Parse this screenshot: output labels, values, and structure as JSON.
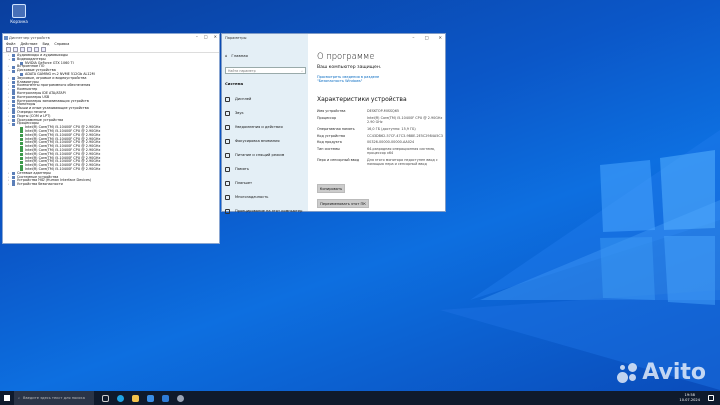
{
  "desktop": {
    "recycle_bin_label": "Корзина"
  },
  "device_manager": {
    "title": "Диспетчер устройств",
    "menu": [
      "Файл",
      "Действие",
      "Вид",
      "Справка"
    ],
    "tree": [
      {
        "label": "Аудиовходы и аудиовыходы",
        "level": 1,
        "arrow": "›"
      },
      {
        "label": "Видеоадаптеры",
        "level": 1,
        "arrow": "⌄"
      },
      {
        "label": "NVIDIA GeForce GTX 1060 TI",
        "level": 2,
        "arrow": ""
      },
      {
        "label": "Встроенное ПО",
        "level": 1,
        "arrow": "›"
      },
      {
        "label": "Дисковые устройства",
        "level": 1,
        "arrow": "⌄"
      },
      {
        "label": "ADATA GAMING m.2 NVME 512Gb AL12M",
        "level": 2,
        "arrow": ""
      },
      {
        "label": "Звуковые, игровые и видеоустройства",
        "level": 1,
        "arrow": "›"
      },
      {
        "label": "Клавиатуры",
        "level": 1,
        "arrow": "›"
      },
      {
        "label": "Компоненты программного обеспечения",
        "level": 1,
        "arrow": "›"
      },
      {
        "label": "Компьютер",
        "level": 1,
        "arrow": "›"
      },
      {
        "label": "Контроллеры IDE ATA/ATAPI",
        "level": 1,
        "arrow": "›"
      },
      {
        "label": "Контроллеры USB",
        "level": 1,
        "arrow": "›"
      },
      {
        "label": "Контроллеры запоминающих устройств",
        "level": 1,
        "arrow": "›"
      },
      {
        "label": "Мониторы",
        "level": 1,
        "arrow": "›"
      },
      {
        "label": "Мыши и иные указывающие устройства",
        "level": 1,
        "arrow": "›"
      },
      {
        "label": "Очереди печати",
        "level": 1,
        "arrow": "›"
      },
      {
        "label": "Порты (COM и LPT)",
        "level": 1,
        "arrow": "›"
      },
      {
        "label": "Программные устройства",
        "level": 1,
        "arrow": "›"
      },
      {
        "label": "Процессоры",
        "level": 1,
        "arrow": "⌄"
      },
      {
        "label": "Intel(R) Core(TM) i5-10400F CPU @ 2.90GHz",
        "level": 2,
        "arrow": "",
        "cpu": true
      },
      {
        "label": "Intel(R) Core(TM) i5-10400F CPU @ 2.90GHz",
        "level": 2,
        "arrow": "",
        "cpu": true
      },
      {
        "label": "Intel(R) Core(TM) i5-10400F CPU @ 2.90GHz",
        "level": 2,
        "arrow": "",
        "cpu": true
      },
      {
        "label": "Intel(R) Core(TM) i5-10400F CPU @ 2.90GHz",
        "level": 2,
        "arrow": "",
        "cpu": true
      },
      {
        "label": "Intel(R) Core(TM) i5-10400F CPU @ 2.90GHz",
        "level": 2,
        "arrow": "",
        "cpu": true
      },
      {
        "label": "Intel(R) Core(TM) i5-10400F CPU @ 2.90GHz",
        "level": 2,
        "arrow": "",
        "cpu": true
      },
      {
        "label": "Intel(R) Core(TM) i5-10400F CPU @ 2.90GHz",
        "level": 2,
        "arrow": "",
        "cpu": true
      },
      {
        "label": "Intel(R) Core(TM) i5-10400F CPU @ 2.90GHz",
        "level": 2,
        "arrow": "",
        "cpu": true
      },
      {
        "label": "Intel(R) Core(TM) i5-10400F CPU @ 2.90GHz",
        "level": 2,
        "arrow": "",
        "cpu": true
      },
      {
        "label": "Intel(R) Core(TM) i5-10400F CPU @ 2.90GHz",
        "level": 2,
        "arrow": "",
        "cpu": true
      },
      {
        "label": "Intel(R) Core(TM) i5-10400F CPU @ 2.90GHz",
        "level": 2,
        "arrow": "",
        "cpu": true
      },
      {
        "label": "Intel(R) Core(TM) i5-10400F CPU @ 2.90GHz",
        "level": 2,
        "arrow": "",
        "cpu": true
      },
      {
        "label": "Сетевые адаптеры",
        "level": 1,
        "arrow": "›"
      },
      {
        "label": "Системные устройства",
        "level": 1,
        "arrow": "›"
      },
      {
        "label": "Устройства HID (Human Interface Devices)",
        "level": 1,
        "arrow": "›"
      },
      {
        "label": "Устройства безопасности",
        "level": 1,
        "arrow": "›"
      }
    ]
  },
  "settings": {
    "app_title": "Параметры",
    "home_label": "Главная",
    "search_placeholder": "Найти параметр",
    "section_label": "Система",
    "nav": [
      {
        "label": "Дисплей",
        "icon": "display-icon"
      },
      {
        "label": "Звук",
        "icon": "sound-icon"
      },
      {
        "label": "Уведомления и действия",
        "icon": "notifications-icon"
      },
      {
        "label": "Фокусировка внимания",
        "icon": "focus-icon"
      },
      {
        "label": "Питание и спящий режим",
        "icon": "power-icon"
      },
      {
        "label": "Память",
        "icon": "storage-icon"
      },
      {
        "label": "Планшет",
        "icon": "tablet-icon"
      },
      {
        "label": "Многозадачность",
        "icon": "multitasking-icon"
      },
      {
        "label": "Проецирование на этот компьютер",
        "icon": "projecting-icon"
      }
    ],
    "about_title": "О программе",
    "protected_text": "Ваш компьютер защищен.",
    "security_link": "Просмотреть сведения в разделе \"Безопасность Windows\"",
    "spec_heading": "Характеристики устройства",
    "specs": [
      {
        "key": "Имя устройства",
        "value": "DESKTOP-MISSQ65"
      },
      {
        "key": "Процессор",
        "value": "Intel(R) Core(TM) i5-10400F CPU @ 2.90GHz   2.90 GHz"
      },
      {
        "key": "Оперативная память",
        "value": "16,0 ГБ (доступно: 15,9 ГБ)"
      },
      {
        "key": "Код устройства",
        "value": "CC43DB62-57CF-47C3-9B8E-2E5C2984A5C3"
      },
      {
        "key": "Код продукта",
        "value": "00326-00000-00000-AA024"
      },
      {
        "key": "Тип системы",
        "value": "64-разрядная операционная система, процессор x64"
      },
      {
        "key": "Перо и сенсорный ввод",
        "value": "Для этого монитора недоступен ввод с помощью пера и сенсорный ввод"
      }
    ],
    "copy_button": "Копировать",
    "rename_button": "Переименовать этот ПК"
  },
  "taskbar": {
    "search_placeholder": "Введите здесь текст для поиска",
    "time": "19:58",
    "date": "10.07.2024"
  },
  "watermark": {
    "text": "Avito"
  },
  "colors": {
    "desktop": "#0b57c8",
    "taskbar": "#0f1a2c",
    "settings_sidebar": "#e4eff6",
    "link": "#0067c0"
  }
}
